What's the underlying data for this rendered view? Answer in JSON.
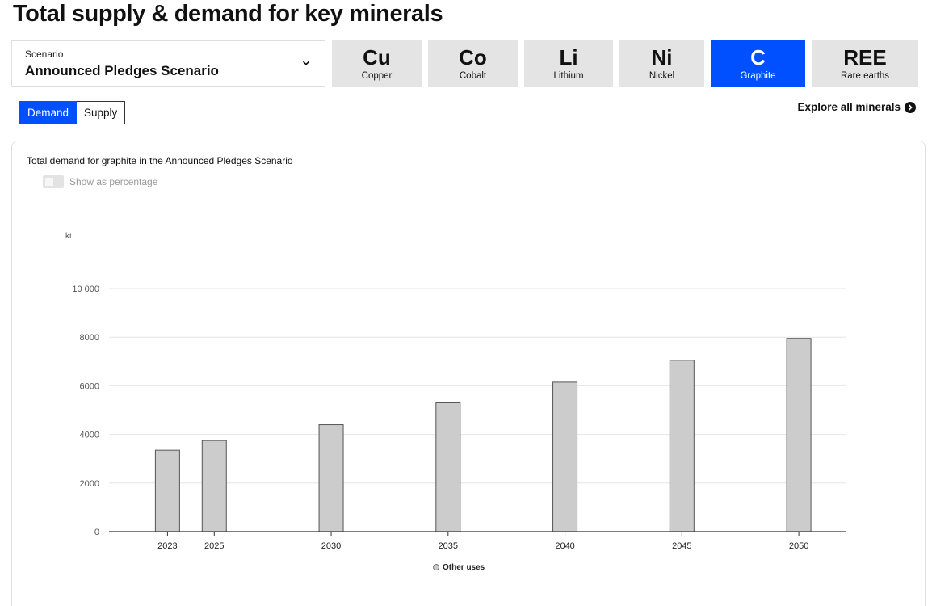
{
  "page": {
    "title": "Total supply & demand for key minerals"
  },
  "scenario": {
    "label": "Scenario",
    "value": "Announced Pledges Scenario"
  },
  "minerals": [
    {
      "symbol": "Cu",
      "name": "Copper",
      "active": false
    },
    {
      "symbol": "Co",
      "name": "Cobalt",
      "active": false
    },
    {
      "symbol": "Li",
      "name": "Lithium",
      "active": false
    },
    {
      "symbol": "Ni",
      "name": "Nickel",
      "active": false
    },
    {
      "symbol": "C",
      "name": "Graphite",
      "active": true
    },
    {
      "symbol": "REE",
      "name": "Rare earths",
      "active": false
    }
  ],
  "view_toggle": {
    "demand_label": "Demand",
    "supply_label": "Supply",
    "selected": "Demand"
  },
  "explore": {
    "label": "Explore all minerals"
  },
  "chart_panel": {
    "title": "Total demand for graphite in the Announced Pledges Scenario",
    "percentage_toggle_label": "Show as percentage",
    "percentage_on": false
  },
  "chart_data": {
    "type": "bar",
    "title": "Total demand for graphite in the Announced Pledges Scenario",
    "xlabel": "",
    "ylabel": "kt",
    "x": [
      2023,
      2025,
      2030,
      2035,
      2040,
      2045,
      2050
    ],
    "xlim": [
      2020.5,
      2052
    ],
    "ylim": [
      0,
      10000
    ],
    "yticks": [
      0,
      2000,
      4000,
      6000,
      8000,
      10000
    ],
    "ytick_labels": [
      "0",
      "2000",
      "4000",
      "6000",
      "8000",
      "10 000"
    ],
    "series": [
      {
        "name": "Other uses",
        "values": [
          3350,
          3750,
          4400,
          5300,
          6150,
          7050,
          7950
        ],
        "color": "#cccccc"
      }
    ],
    "grid": true,
    "legend_position": "bottom"
  }
}
